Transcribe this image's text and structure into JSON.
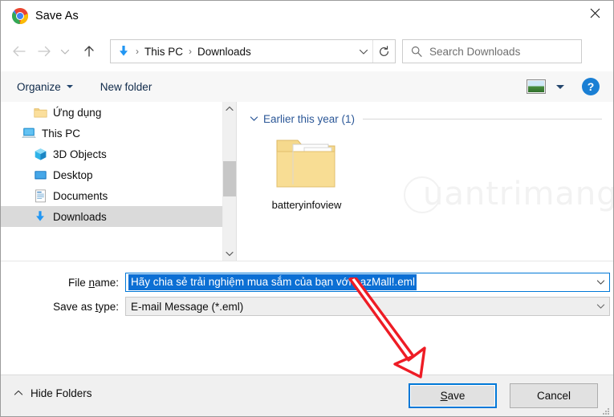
{
  "window": {
    "title": "Save As",
    "app_icon": "chrome-logo-icon",
    "close_label": "✕"
  },
  "nav": {
    "back_icon": "arrow-left-icon",
    "forward_icon": "arrow-right-icon",
    "recent_icon": "chevron-down-icon",
    "up_icon": "arrow-up-icon",
    "refresh_icon": "refresh-icon",
    "breadcrumb_icon": "downloads-arrow-icon",
    "breadcrumb": [
      "This PC",
      "Downloads"
    ],
    "separator": "›",
    "dropdown_icon": "chevron-down-icon"
  },
  "search": {
    "placeholder": "Search Downloads",
    "icon": "search-icon",
    "value": ""
  },
  "toolbar": {
    "organize_label": "Organize",
    "new_folder_label": "New folder",
    "view_icon": "view-layout-icon",
    "view_dropdown_icon": "chevron-down-icon",
    "help_label": "?"
  },
  "navpane": {
    "items": [
      {
        "label": "Ứng dụng",
        "icon": "folder-icon",
        "indent": 2,
        "selected": false
      },
      {
        "label": "This PC",
        "icon": "this-pc-icon",
        "indent": 1,
        "selected": false
      },
      {
        "label": "3D Objects",
        "icon": "3d-objects-icon",
        "indent": 2,
        "selected": false
      },
      {
        "label": "Desktop",
        "icon": "desktop-icon",
        "indent": 2,
        "selected": false
      },
      {
        "label": "Documents",
        "icon": "documents-icon",
        "indent": 2,
        "selected": false
      },
      {
        "label": "Downloads",
        "icon": "downloads-icon",
        "indent": 2,
        "selected": true
      }
    ],
    "scrollbar_up_icon": "chevron-up-icon",
    "scrollbar_down_icon": "chevron-down-icon"
  },
  "filelist": {
    "group_label": "Earlier this year (1)",
    "group_chevron_icon": "chevron-down-icon",
    "items": [
      {
        "name": "batteryinfoview",
        "icon": "folder-large-icon"
      }
    ],
    "watermark": "uantrimang"
  },
  "form": {
    "filename_label_pre": "File ",
    "filename_label_accel": "n",
    "filename_label_post": "ame:",
    "filename_value": "Hãy chia sẻ trải nghiệm mua sắm của bạn với LazMall!.eml",
    "filetype_label_pre": "Save as ",
    "filetype_label_accel": "t",
    "filetype_label_post": "ype:",
    "filetype_value": "E-mail Message (*.eml)",
    "dropdown_icon": "chevron-down-icon"
  },
  "footer": {
    "hide_folders_label": "Hide Folders",
    "hide_folders_icon": "chevron-up-icon",
    "save_label_pre": "",
    "save_label_accel": "S",
    "save_label_post": "ave",
    "cancel_label": "Cancel",
    "resize_grip_icon": "resize-grip-icon"
  },
  "annotation": {
    "arrow_color": "#ee1c25"
  },
  "colors": {
    "accent": "#0078d7",
    "selection": "#0c6fd4",
    "breadcrumb_blue": "#2b5797",
    "toolbar_bg": "#f7f7f7",
    "footer_bg": "#f0f0f0"
  }
}
